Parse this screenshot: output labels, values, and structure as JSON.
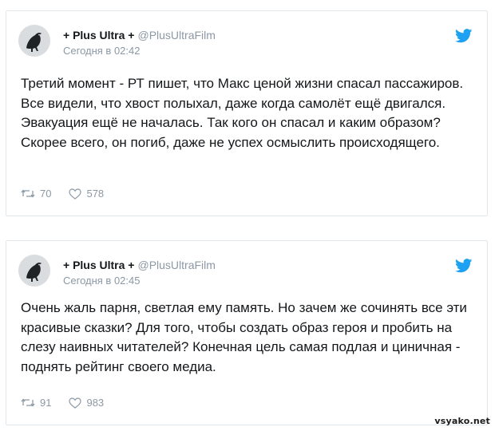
{
  "tweets": [
    {
      "display_name": "+ Plus Ultra +",
      "handle": "@PlusUltraFilm",
      "timestamp": "Сегодня в 02:42",
      "text": "Третий момент - РТ пишет, что Макс ценой жизни спасал пассажиров. Все видели, что хвост полыхал, даже когда самолёт ещё двигался. Эвакуация ещё не началась. Так кого он спасал и каким образом? Скорее всего, он погиб, даже не успех осмыслить происходящего.",
      "retweets": "70",
      "likes": "578"
    },
    {
      "display_name": "+ Plus Ultra +",
      "handle": "@PlusUltraFilm",
      "timestamp": "Сегодня в 02:45",
      "text": "Очень жаль парня, светлая ему память. Но зачем же сочинять все эти красивые сказки? Для того, чтобы создать образ героя и пробить на слезу наивных читателей? Конечная цель самая подлая и циничная - поднять рейтинг своего медиа.",
      "retweets": "91",
      "likes": "983"
    }
  ],
  "icons": {
    "brand": "twitter-bird-icon",
    "retweet": "retweet-icon",
    "like": "heart-icon",
    "avatar": "crow-avatar"
  },
  "colors": {
    "twitter_blue": "#1da1f2",
    "muted_text": "#8b98a5",
    "card_border": "#e1e8ed"
  },
  "watermark": "vsyako.net"
}
